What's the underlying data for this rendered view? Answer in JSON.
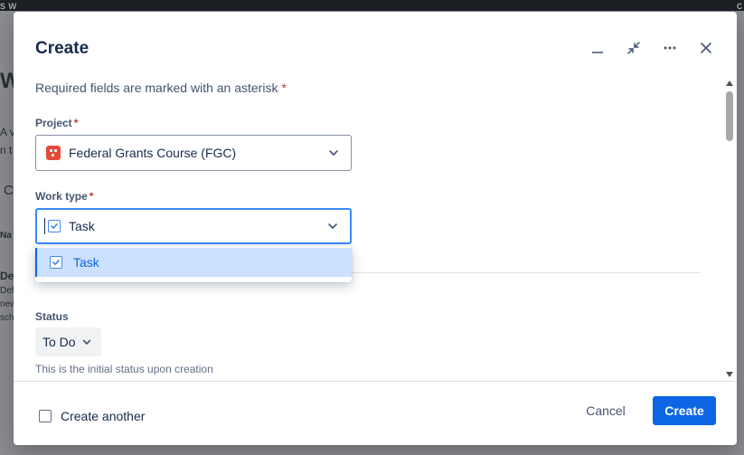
{
  "background": {
    "topbar_left": "s w",
    "topbar_right": "c",
    "frag_w": "W",
    "frag_a": "A v",
    "frag_n": "n t",
    "frag_c": "C",
    "frag_na": "Na",
    "frag_de": "De",
    "frag_def": "Def",
    "frag_new": "new",
    "frag_sch": "sch"
  },
  "modal": {
    "title": "Create",
    "header_icons": [
      "minimize-icon",
      "collapse-icon",
      "more-icon",
      "close-icon"
    ],
    "required_note": "Required fields are marked with an asterisk",
    "asterisk": "*"
  },
  "project_field": {
    "label": "Project",
    "value": "Federal Grants Course (FGC)",
    "icon_color": "#e5493a"
  },
  "work_type_field": {
    "label": "Work type",
    "value": "Task",
    "options": [
      "Task"
    ],
    "focus_color": "#388bff"
  },
  "status_field": {
    "label": "Status",
    "value": "To Do",
    "helper": "This is the initial status upon creation"
  },
  "footer": {
    "create_another": "Create another",
    "cancel": "Cancel",
    "create": "Create",
    "primary_color": "#0c66e4"
  }
}
